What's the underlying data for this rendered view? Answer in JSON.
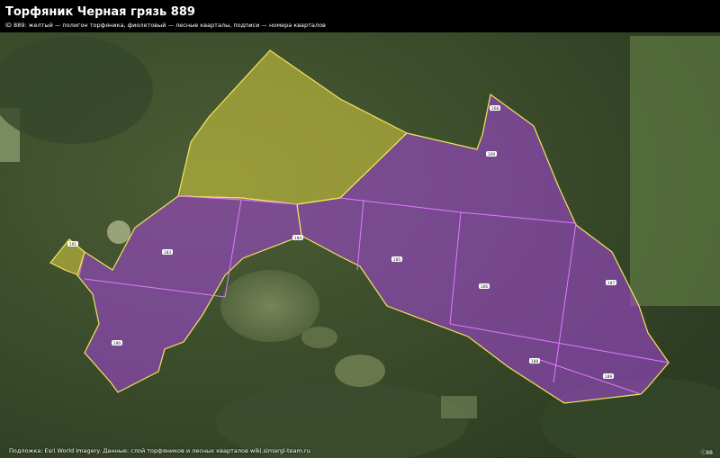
{
  "header": {
    "title": "Торфяник Черная грязь 889",
    "subtitle": "ID 889: желтый — полигон торфяника, фиолетовый — лесные кварталы, подписи — номера кварталов"
  },
  "footer": {
    "credit": "Подложка: Esri World Imagery. Данные: слой торфяников и лесных кварталов wiki.simargl-team.ru",
    "corner": "ⓒ88"
  },
  "legend": {
    "peat_color": "#e6d84a",
    "quarter_color": "#b04ad8"
  },
  "quarters": {
    "q1": "168",
    "q2": "169",
    "q3": "183",
    "q4": "184",
    "q5": "185",
    "q6": "186",
    "q7": "187",
    "q8": "188",
    "q9": "189",
    "q10": "190",
    "q11": "191",
    "q12": "192"
  }
}
